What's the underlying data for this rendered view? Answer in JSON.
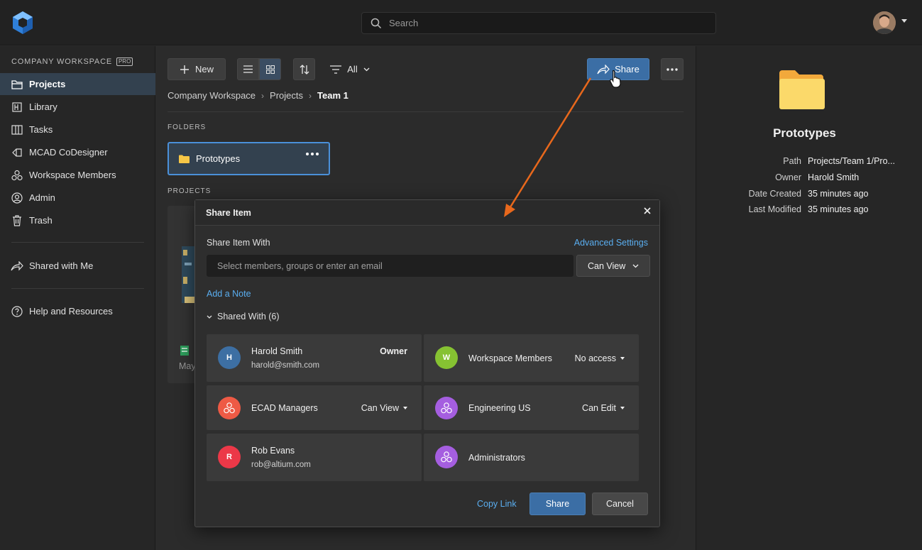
{
  "search": {
    "placeholder": "Search"
  },
  "sidebar": {
    "workspace_title": "COMPANY WORKSPACE",
    "badge": "PRO",
    "items": [
      {
        "label": "Projects",
        "icon": "folder-icon",
        "active": true
      },
      {
        "label": "Library",
        "icon": "library-icon"
      },
      {
        "label": "Tasks",
        "icon": "tasks-icon"
      },
      {
        "label": "MCAD CoDesigner",
        "icon": "mcad-icon"
      },
      {
        "label": "Workspace Members",
        "icon": "members-icon"
      },
      {
        "label": "Admin",
        "icon": "admin-icon"
      },
      {
        "label": "Trash",
        "icon": "trash-icon"
      },
      {
        "label": "Shared with Me",
        "icon": "shared-icon"
      },
      {
        "label": "Help and Resources",
        "icon": "help-icon"
      }
    ]
  },
  "toolbar": {
    "new_label": "New",
    "filter_label": "All",
    "share_label": "Share"
  },
  "breadcrumb": [
    "Company Workspace",
    "Projects",
    "Team 1"
  ],
  "main": {
    "folders_label": "FOLDERS",
    "projects_label": "PROJECTS",
    "folder_name": "Prototypes",
    "project_partial_text": "May"
  },
  "details": {
    "title": "Prototypes",
    "props": [
      {
        "key": "Path",
        "value": "Projects/Team 1/Pro..."
      },
      {
        "key": "Owner",
        "value": "Harold Smith"
      },
      {
        "key": "Date Created",
        "value": "35 minutes ago"
      },
      {
        "key": "Last Modified",
        "value": "35 minutes ago"
      }
    ]
  },
  "dialog": {
    "title": "Share Item",
    "share_with_label": "Share Item With",
    "advanced_settings": "Advanced Settings",
    "input_placeholder": "Select members, groups or enter an email",
    "permission": "Can View",
    "add_note": "Add a Note",
    "shared_with": "Shared With (6)",
    "entries": [
      {
        "name": "Harold Smith",
        "email": "harold@smith.com",
        "role": "Owner",
        "avatar": "H",
        "color": "#3d6fa3"
      },
      {
        "name": "Workspace Members",
        "email": "",
        "role": "No access",
        "avatar": "W",
        "color": "#86c232"
      },
      {
        "name": "ECAD Managers",
        "email": "",
        "role": "Can View",
        "avatar": "group-icon",
        "color": "#ee5a45"
      },
      {
        "name": "Engineering US",
        "email": "",
        "role": "Can Edit",
        "avatar": "group-icon",
        "color": "#a55ee0"
      },
      {
        "name": "Rob Evans",
        "email": "rob@altium.com",
        "role": "",
        "avatar": "R",
        "color": "#ec3848"
      },
      {
        "name": "Administrators",
        "email": "",
        "role": "",
        "avatar": "group-icon",
        "color": "#a55ee0"
      }
    ],
    "copy_link": "Copy Link",
    "share_button": "Share",
    "cancel_button": "Cancel"
  },
  "colors": {
    "accent": "#3b6ea5",
    "link": "#5aaef0",
    "annotation_arrow": "#e8681c",
    "folder": "#f6c646"
  }
}
